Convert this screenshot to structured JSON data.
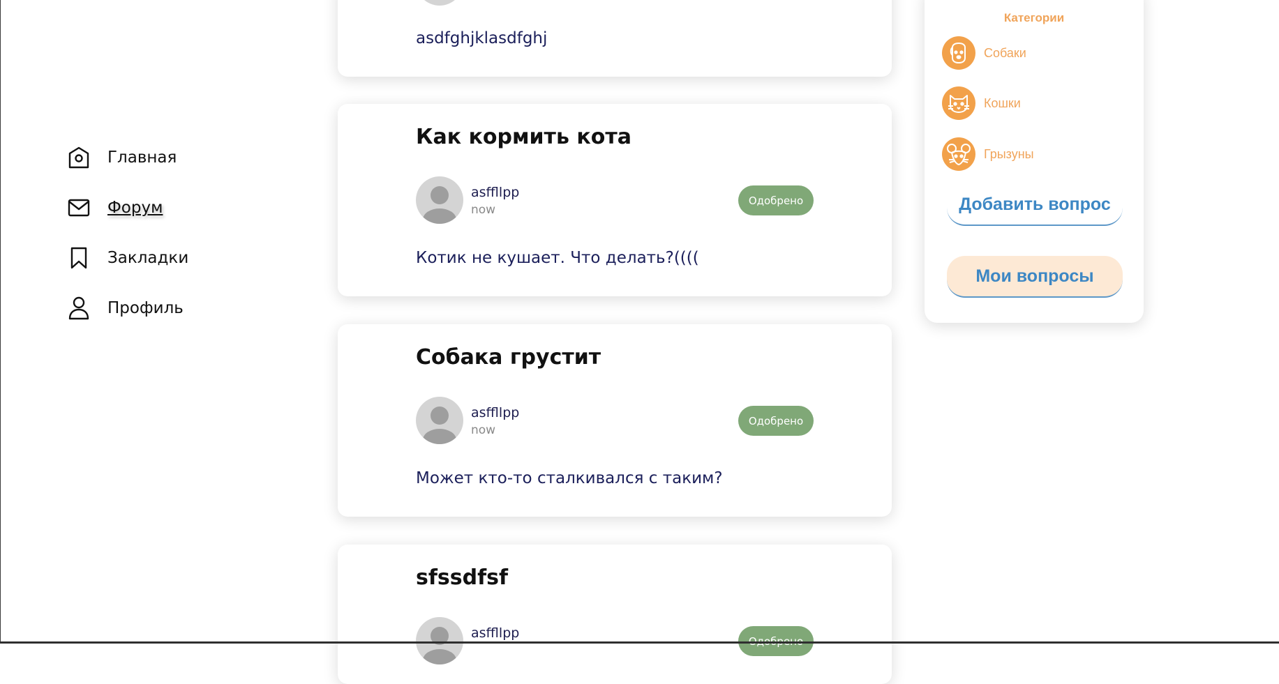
{
  "nav": {
    "items": [
      {
        "label": "Главная",
        "icon": "home-icon"
      },
      {
        "label": "Форум",
        "icon": "mail-icon",
        "active": true
      },
      {
        "label": "Закладки",
        "icon": "bookmark-icon"
      },
      {
        "label": "Профиль",
        "icon": "user-icon"
      }
    ]
  },
  "posts": [
    {
      "body": "asdfghjklasdfghj"
    },
    {
      "title": "Как кормить кота",
      "author": "asffllpp",
      "time": "now",
      "status": "Одобрено",
      "body": "Котик не кушает. Что делать?(((("
    },
    {
      "title": "Собака грустит",
      "author": "asffllpp",
      "time": "now",
      "status": "Одобрено",
      "body": "Может кто-то сталкивался с таким?"
    },
    {
      "title": "sfssdfsf",
      "author": "asffllpp",
      "status": "Одобрено"
    }
  ],
  "sidebar": {
    "categories_heading": "Категории",
    "categories": [
      {
        "label": "Собаки",
        "icon": "dog-icon"
      },
      {
        "label": "Кошки",
        "icon": "cat-icon"
      },
      {
        "label": "Грызуны",
        "icon": "mouse-icon"
      }
    ],
    "add_question_label": "Добавить вопрос",
    "my_questions_label": "Мои вопросы"
  },
  "colors": {
    "accent_orange": "#f2a14a",
    "approved_green": "#80a877",
    "button_blue": "#3d87c4",
    "text_navy": "#1b1f5a"
  }
}
